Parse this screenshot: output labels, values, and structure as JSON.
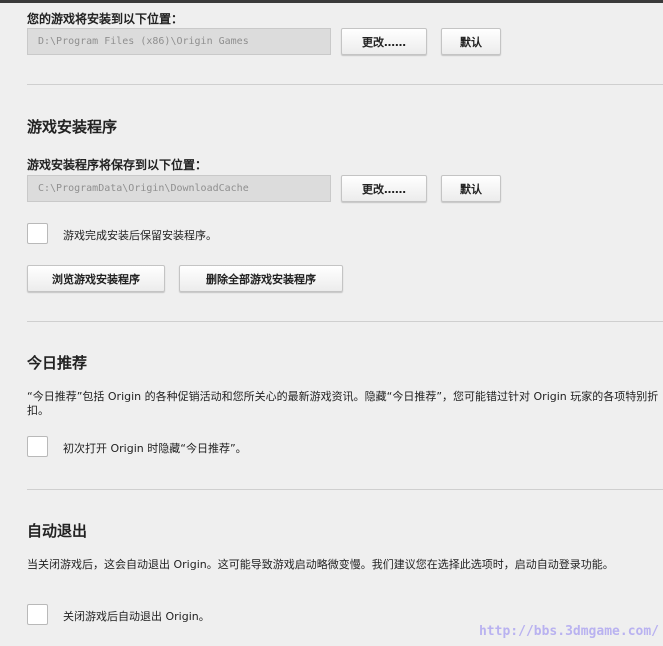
{
  "install_location": {
    "label": "您的游戏将安装到以下位置：",
    "path": "D:\\Program Files (x86)\\Origin Games",
    "change_button": "更改……",
    "default_button": "默认"
  },
  "installers": {
    "title": "游戏安装程序",
    "label": "游戏安装程序将保存到以下位置：",
    "path": "C:\\ProgramData\\Origin\\DownloadCache",
    "change_button": "更改……",
    "default_button": "默认",
    "keep_checkbox_label": "游戏完成安装后保留安装程序。",
    "browse_button": "浏览游戏安装程序",
    "delete_all_button": "删除全部游戏安装程序"
  },
  "todays_picks": {
    "title": "今日推荐",
    "description": "“今日推荐”包括 Origin 的各种促销活动和您所关心的最新游戏资讯。隐藏“今日推荐”，您可能错过针对 Origin 玩家的各项特别折扣。",
    "checkbox_label": "初次打开 Origin 时隐藏“今日推荐”。"
  },
  "auto_exit": {
    "title": "自动退出",
    "description": "当关闭游戏后，这会自动退出 Origin。这可能导致游戏启动略微变慢。我们建议您在选择此选项时，启动自动登录功能。",
    "checkbox_label": "关闭游戏后自动退出 Origin。"
  },
  "watermark": "http://bbs.3dmgame.com/"
}
